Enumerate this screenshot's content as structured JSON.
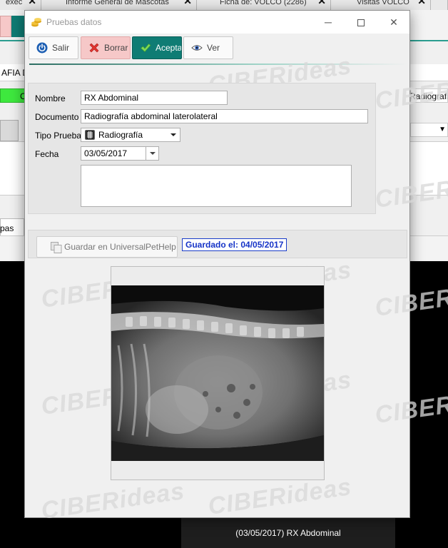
{
  "background": {
    "tabs": [
      {
        "label": "exec"
      },
      {
        "label": "Informe General de Mascotas"
      },
      {
        "label": "Ficha de: VOLCO (2286)"
      },
      {
        "label": "Visitas VOLCO"
      }
    ],
    "row_text_left": "AFIA DI",
    "green_text": "C",
    "right_text": "Radiografia",
    "tab_label": "pas",
    "caption": "(03/05/2017) RX Abdominal"
  },
  "dialog": {
    "title": "Pruebas datos",
    "toolbar": {
      "exit_label": "Salir",
      "delete_label": "Borrar",
      "accept_label": "Aceptar",
      "view_label": "Ver"
    },
    "form": {
      "name_label": "Nombre",
      "name_value": "RX Abdominal",
      "document_label": "Documento",
      "document_value": "Radiografía abdominal laterolateral",
      "test_type_label": "Tipo Prueba",
      "test_type_value": "Radiografía",
      "date_label": "Fecha",
      "date_value": "03/05/2017",
      "notes_value": ""
    },
    "save_button_label": "Guardar en UniversalPetHelp",
    "saved_status": "Guardado el: 04/05/2017",
    "watermark": "CIBERideas"
  },
  "colors": {
    "accent": "#2a9d8f",
    "accept_bg": "#0f7c74",
    "delete_bg": "#f6c8c8",
    "status_blue": "#1533c7"
  }
}
